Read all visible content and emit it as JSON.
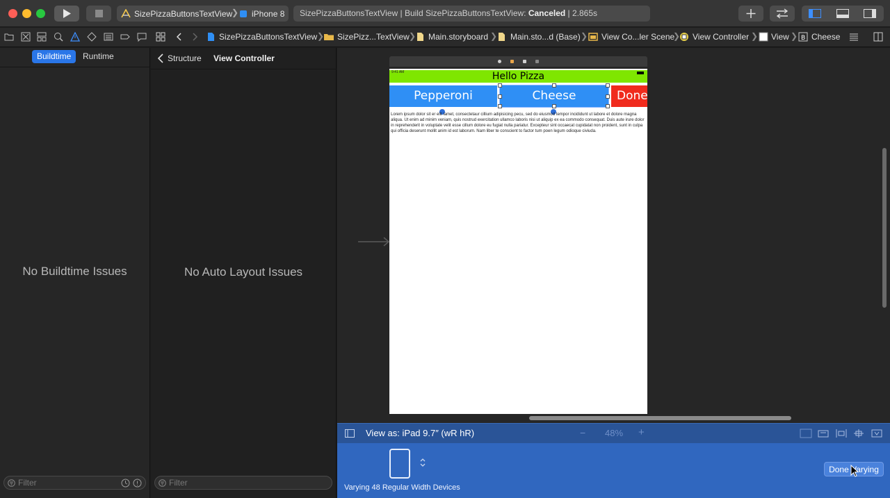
{
  "toolbar": {
    "scheme_target": "SizePizzaButtonsTextView",
    "scheme_device": "iPhone 8",
    "activity_prefix": "SizePizzaButtonsTextView | Build SizePizzaButtonsTextView: ",
    "activity_status": "Canceled",
    "activity_time": " | 2.865s"
  },
  "breadcrumb": [
    "SizePizzaButtonsTextView",
    "SizePizz...TextView",
    "Main.storyboard",
    "Main.sto...d (Base)",
    "View Co...ler Scene",
    "View Controller",
    "View",
    "Cheese"
  ],
  "issues_panel": {
    "tab_buildtime": "Buildtime",
    "tab_runtime": "Runtime",
    "empty_message": "No Buildtime Issues",
    "filter_placeholder": "Filter"
  },
  "structure_panel": {
    "back_label": "Structure",
    "title": "View Controller",
    "empty_message": "No Auto Layout Issues",
    "filter_placeholder": "Filter"
  },
  "device": {
    "status_time": "9:41 AM",
    "nav_title": "Hello Pizza",
    "buttons": [
      "Pepperoni",
      "Cheese",
      "Done"
    ],
    "text_content": "Lorem ipsum dolor sit er elit lamet, consectetaur cillium adipisicing pecu, sed do eiusmod tempor incididunt ut labore et dolore magna aliqua. Ut enim ad minim veniam, quis nostrud exercitation ullamco laboris nisi ut aliquip ex ea commodo consequat. Duis aute irure dolor in reprehenderit in voluptate velit esse cillum dolore eu fugiat nulla pariatur. Excepteur sint occaecat cupidatat non proident, sunt in culpa qui officia deserunt mollit anim id est laborum. Nam liber te conscient to factor tum poen legum odioque civiuda."
  },
  "view_as": {
    "label": "View as: iPad 9.7″ (wR hR)",
    "zoom": "48%",
    "zoom_out": "−",
    "zoom_in": "+"
  },
  "varying": {
    "caption": "Varying 48 Regular Width Devices",
    "done_button": "Done Varying"
  },
  "colors": {
    "button_blue": "#2f8ff5",
    "done_red": "#f02b1d",
    "nav_green": "#7fe600",
    "varying_blue": "#3067bf",
    "accent": "#2a76e8"
  }
}
